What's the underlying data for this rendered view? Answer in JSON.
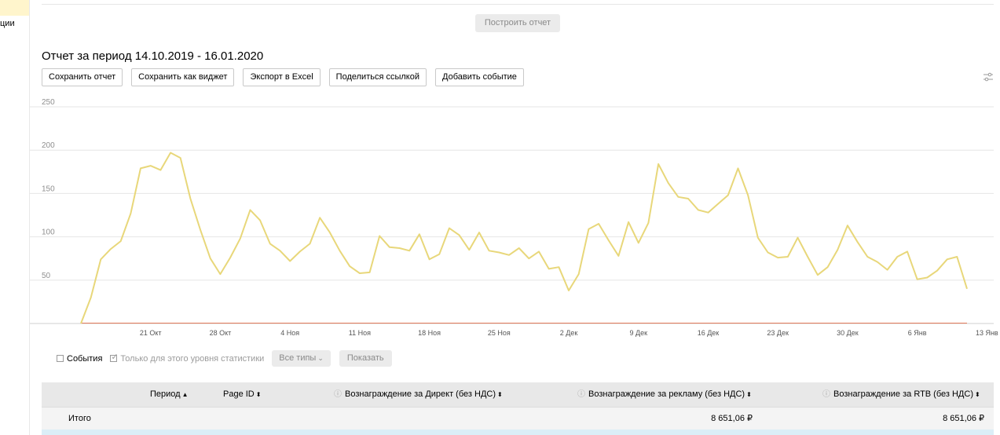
{
  "sidebar": {
    "fragment": "ции"
  },
  "build_button": "Построить отчет",
  "report": {
    "title": "Отчет за период 14.10.2019 - 16.01.2020",
    "actions": [
      "Сохранить отчет",
      "Сохранить как виджет",
      "Экспорт в Excel",
      "Поделиться ссылкой",
      "Добавить событие"
    ]
  },
  "chart_data": {
    "type": "line",
    "ylim": [
      0,
      250
    ],
    "yticks": [
      50,
      100,
      150,
      200,
      250
    ],
    "xticks": [
      {
        "label": "21 Окт",
        "index": 7
      },
      {
        "label": "28 Окт",
        "index": 14
      },
      {
        "label": "4 Ноя",
        "index": 21
      },
      {
        "label": "11 Ноя",
        "index": 28
      },
      {
        "label": "18 Ноя",
        "index": 35
      },
      {
        "label": "25 Ноя",
        "index": 42
      },
      {
        "label": "2 Дек",
        "index": 49
      },
      {
        "label": "9 Дек",
        "index": 56
      },
      {
        "label": "16 Дек",
        "index": 63
      },
      {
        "label": "23 Дек",
        "index": 70
      },
      {
        "label": "30 Дек",
        "index": 77
      },
      {
        "label": "6 Янв",
        "index": 84
      },
      {
        "label": "13 Янв",
        "index": 91
      }
    ],
    "grid": true,
    "series": [
      {
        "color": "#e8d77a",
        "values": [
          0,
          30,
          74,
          86,
          95,
          127,
          179,
          182,
          177,
          197,
          191,
          144,
          108,
          75,
          57,
          76,
          98,
          131,
          119,
          92,
          84,
          72,
          83,
          92,
          122,
          105,
          84,
          66,
          58,
          59,
          101,
          88,
          87,
          84,
          103,
          74,
          80,
          110,
          102,
          85,
          105,
          84,
          82,
          79,
          87,
          75,
          83,
          63,
          65,
          38,
          57,
          109,
          115,
          96,
          78,
          117,
          93,
          116,
          184,
          162,
          146,
          144,
          131,
          128,
          138,
          148,
          179,
          148,
          99,
          82,
          76,
          77,
          99,
          77,
          56,
          65,
          85,
          113,
          94,
          77,
          71,
          62,
          77,
          83,
          51,
          53,
          61,
          74,
          77,
          40
        ]
      },
      {
        "color": "#e37b5b",
        "values": [
          0,
          0
        ]
      }
    ]
  },
  "controls": {
    "events": "События",
    "level_only": "Только для этого уровня статистики",
    "types": "Все типы",
    "show": "Показать"
  },
  "table": {
    "headers": {
      "period": "Период",
      "page_id": "Page ID",
      "direct": "Вознаграждение за Директ (без НДС)",
      "ads": "Вознаграждение за рекламу (без НДС)",
      "rtb": "Вознаграждение за RTB (без НДС)"
    },
    "total": {
      "label": "Итого",
      "ads": "8 651,06 ₽",
      "rtb": "8 651,06 ₽"
    }
  }
}
